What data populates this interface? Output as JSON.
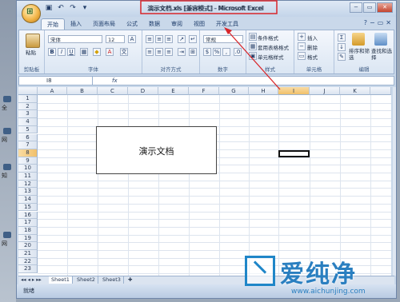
{
  "title": "演示文档.xls [兼容模式] - Microsoft Excel",
  "office_button_glyph": "⊞",
  "background": {
    "left_labels": [
      "全",
      "网",
      "知",
      "网"
    ]
  },
  "window_buttons": [
    "−",
    "▭",
    "✕"
  ],
  "tabs": [
    "开始",
    "插入",
    "页面布局",
    "公式",
    "数据",
    "审阅",
    "视图",
    "开发工具"
  ],
  "help_glyphs": [
    "?",
    "−",
    "▭",
    "✕"
  ],
  "ribbon": {
    "clipboard": {
      "paste_label": "粘贴",
      "group_label": "剪贴板"
    },
    "font": {
      "font_name": "宋体",
      "font_size": "12",
      "bold": "B",
      "italic": "I",
      "underline": "U",
      "group_label": "字体"
    },
    "alignment": {
      "group_label": "对齐方式"
    },
    "number": {
      "format": "常规",
      "percent": "%",
      "group_label": "数字"
    },
    "styles": {
      "conditional": "条件格式",
      "table_format": "套用表格格式",
      "cell_styles": "单元格样式",
      "group_label": "样式"
    },
    "cells": {
      "insert": "插入",
      "delete": "删除",
      "format": "格式",
      "group_label": "单元格"
    },
    "editing": {
      "sort_filter": "排序和筛选",
      "find_select": "查找和选择",
      "group_label": "编辑"
    }
  },
  "formula_bar": {
    "name_box": "I8",
    "fx": "fx"
  },
  "columns": [
    "A",
    "B",
    "C",
    "D",
    "E",
    "F",
    "G",
    "H",
    "I",
    "J",
    "K"
  ],
  "selected_column": "I",
  "rows": [
    "1",
    "2",
    "3",
    "4",
    "5",
    "6",
    "7",
    "8",
    "9",
    "10",
    "11",
    "12",
    "13",
    "14",
    "15",
    "16",
    "17",
    "18",
    "19",
    "20",
    "21",
    "22",
    "23"
  ],
  "selected_row": "8",
  "textbox_text": "演示文档",
  "sheets": [
    "Sheet1",
    "Sheet2",
    "Sheet3"
  ],
  "active_sheet": "Sheet1",
  "status": "就绪",
  "watermark": {
    "text": "爱纯净",
    "url": "www.aichunjing.com"
  },
  "colors": {
    "annotation_red": "#d8252a",
    "watermark_blue": "#1f86c8",
    "selected_header": "#f1c06a"
  }
}
